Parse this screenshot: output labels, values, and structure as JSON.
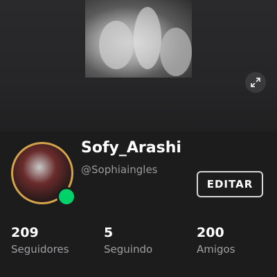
{
  "profile": {
    "display_name": "Sofy_Arashi",
    "username": "@Sophiaingles",
    "edit_label": "EDITAR",
    "online_status_color": "#00d26a",
    "avatar_border_color": "#d4a34a"
  },
  "banner": {
    "expand_icon": "expand-icon"
  },
  "stats": [
    {
      "value": "209",
      "label": "Seguidores"
    },
    {
      "value": "5",
      "label": "Seguindo"
    },
    {
      "value": "200",
      "label": "Amigos"
    }
  ]
}
